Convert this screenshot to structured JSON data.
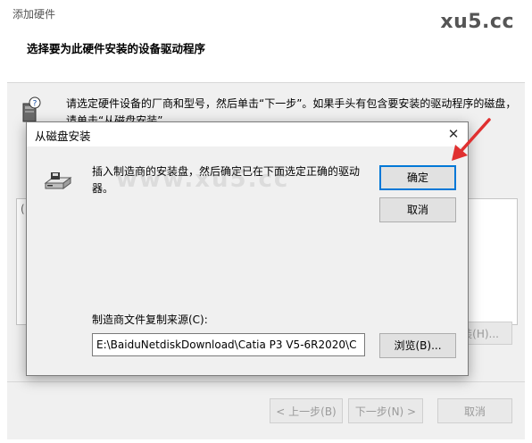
{
  "outer": {
    "window_title": "添加硬件",
    "watermark": "xu5.cc",
    "heading": "选择要为此硬件安装的设备驱动程序",
    "instruction": "请选定硬件设备的厂商和型号，然后单击“下一步”。如果手头有包含要安装的驱动程序的磁盘，请单击“从磁盘安装”。",
    "list_stub": "(",
    "disk_button": "安装(H)...",
    "back_button": "< 上一步(B)",
    "next_button": "下一步(N) >",
    "cancel_button": "取消"
  },
  "modal": {
    "title": "从磁盘安装",
    "close_label": "✕",
    "message": "插入制造商的安装盘，然后确定已在下面选定正确的驱动器。",
    "ok_button": "确定",
    "cancel_button": "取消",
    "source_label": "制造商文件复制来源(C):",
    "source_value": "E:\\BaiduNetdiskDownload\\Catia P3 V5-6R2020\\C",
    "browse_button": "浏览(B)..."
  },
  "overlay_watermark": "www.xu5.cc",
  "colors": {
    "arrow": "#e03030",
    "focus": "#0078d7"
  },
  "icons": [
    "hardware-question-icon",
    "disk-drive-icon",
    "close-icon",
    "red-arrow"
  ]
}
